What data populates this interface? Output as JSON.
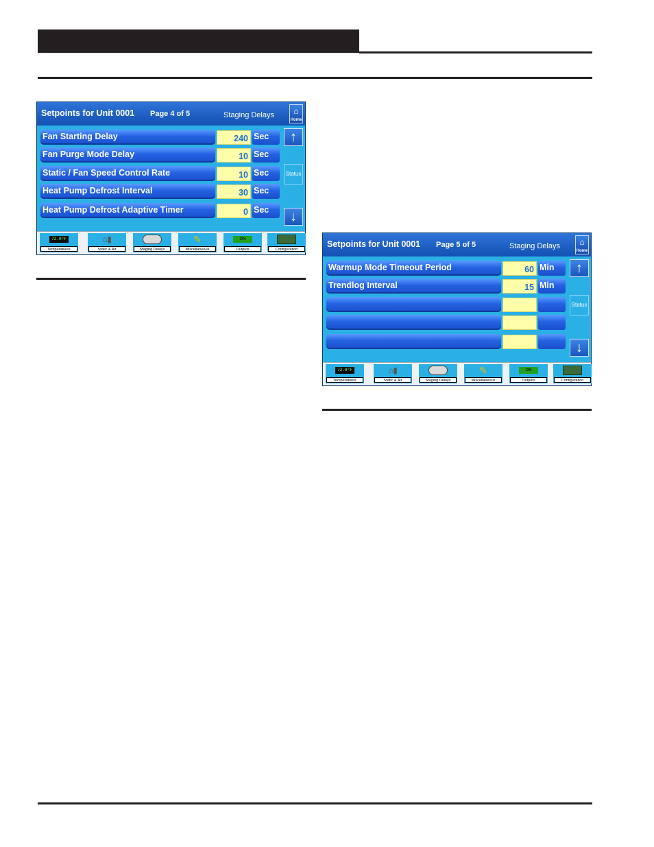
{
  "panels": [
    {
      "title": "Setpoints for Unit 0001",
      "page": "Page 4 of 5",
      "section": "Staging Delays",
      "home_label": "Home",
      "status_label": "Status",
      "rows": [
        {
          "label": "Fan Starting Delay",
          "value": "240",
          "unit": "Sec"
        },
        {
          "label": "Fan Purge Mode Delay",
          "value": "10",
          "unit": "Sec"
        },
        {
          "label": "Static / Fan Speed Control Rate",
          "value": "10",
          "unit": "Sec"
        },
        {
          "label": "Heat Pump Defrost Interval",
          "value": "30",
          "unit": "Sec"
        },
        {
          "label": "Heat Pump Defrost Adaptive Timer",
          "value": "0",
          "unit": "Sec"
        }
      ],
      "nav": [
        {
          "label": "Temperatures",
          "icon": "temperature-display-icon",
          "badge": "72.0°F"
        },
        {
          "label": "Static & Air",
          "icon": "static-air-icon",
          "badge": ""
        },
        {
          "label": "Staging Delays",
          "icon": "staging-delays-icon",
          "badge": ""
        },
        {
          "label": "Miscellaneous",
          "icon": "miscellaneous-icon",
          "badge": ""
        },
        {
          "label": "Outputs",
          "icon": "outputs-icon",
          "badge": "ON"
        },
        {
          "label": "Configuration",
          "icon": "configuration-board-icon",
          "badge": ""
        }
      ]
    },
    {
      "title": "Setpoints for Unit 0001",
      "page": "Page 5 of 5",
      "section": "Staging Delays",
      "home_label": "Home",
      "status_label": "Status",
      "rows": [
        {
          "label": "Warmup Mode Timeout Period",
          "value": "60",
          "unit": "Min"
        },
        {
          "label": "Trendlog Interval",
          "value": "15",
          "unit": "Min"
        },
        {
          "label": "",
          "value": "",
          "unit": ""
        },
        {
          "label": "",
          "value": "",
          "unit": ""
        },
        {
          "label": "",
          "value": "",
          "unit": ""
        }
      ],
      "nav": [
        {
          "label": "Temperatures",
          "icon": "temperature-display-icon",
          "badge": "72.0°F"
        },
        {
          "label": "Static & Air",
          "icon": "static-air-icon",
          "badge": ""
        },
        {
          "label": "Staging Delays",
          "icon": "staging-delays-icon",
          "badge": ""
        },
        {
          "label": "Miscellaneous",
          "icon": "miscellaneous-icon",
          "badge": ""
        },
        {
          "label": "Outputs",
          "icon": "outputs-icon",
          "badge": "ON"
        },
        {
          "label": "Configuration",
          "icon": "configuration-board-icon",
          "badge": ""
        }
      ]
    }
  ],
  "icons": {
    "home": "house-icon",
    "up": "arrow-up-icon",
    "down": "arrow-down-icon"
  },
  "colors": {
    "panel_bg": "#2bb0e6",
    "title_bar": "#1a5cc4",
    "row_button": "#2462e2",
    "value_field": "#ffffaa",
    "value_text": "#1a6fd0"
  }
}
